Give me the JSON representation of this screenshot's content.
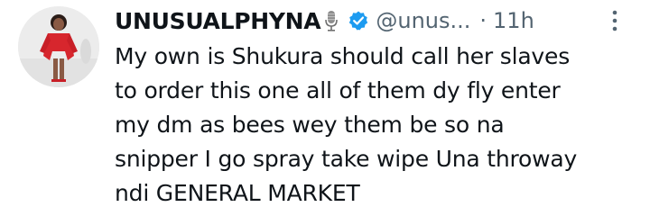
{
  "tweet": {
    "author": {
      "display_name": "UNUSUALPHYNA",
      "handle": "@unus...",
      "avatar_icon": "profile-photo",
      "name_emoji_icon": "microphone-icon",
      "verified_icon": "verified-badge-icon"
    },
    "separator": "·",
    "timestamp": "11h",
    "more_icon": "more-vertical-icon",
    "text_lines": [
      "My own is Shukura should call her slaves",
      "to order this one all of them dy fly enter",
      "my dm as bees wey them be so na",
      "snipper I go spray take wipe Una throway",
      "ndi GENERAL MARKET"
    ]
  },
  "colors": {
    "text": "#0f1419",
    "secondary": "#536471",
    "verified": "#1d9bf0"
  }
}
